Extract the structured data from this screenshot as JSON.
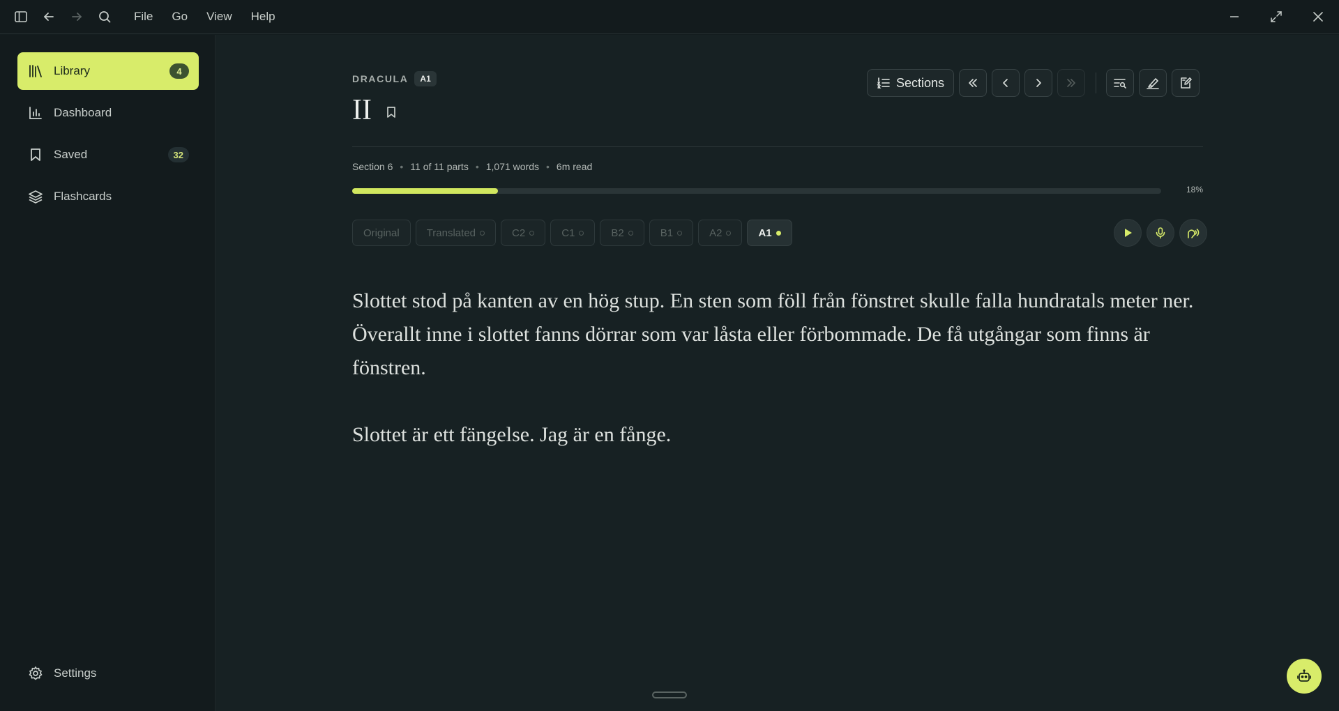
{
  "menu": [
    "File",
    "Go",
    "View",
    "Help"
  ],
  "sidebar": {
    "items": [
      {
        "label": "Library",
        "badge": "4",
        "icon": "library-icon",
        "active": true
      },
      {
        "label": "Dashboard",
        "badge": "",
        "icon": "chart-icon",
        "active": false
      },
      {
        "label": "Saved",
        "badge": "32",
        "icon": "bookmark-icon",
        "active": false
      },
      {
        "label": "Flashcards",
        "badge": "",
        "icon": "layers-icon",
        "active": false
      }
    ],
    "settings_label": "Settings"
  },
  "book": {
    "title": "DRACULA",
    "level": "A1",
    "chapter": "II"
  },
  "toolbar": {
    "sections_label": "Sections"
  },
  "meta": {
    "section": "Section 6",
    "parts": "11 of 11 parts",
    "words": "1,071 words",
    "read_time": "6m read"
  },
  "progress": {
    "value": 0.18,
    "label": "18%"
  },
  "levels": [
    {
      "label": "Original",
      "ring": false,
      "active": false
    },
    {
      "label": "Translated",
      "ring": true,
      "active": false
    },
    {
      "label": "C2",
      "ring": true,
      "active": false
    },
    {
      "label": "C1",
      "ring": true,
      "active": false
    },
    {
      "label": "B2",
      "ring": true,
      "active": false
    },
    {
      "label": "B1",
      "ring": true,
      "active": false
    },
    {
      "label": "A2",
      "ring": true,
      "active": false
    },
    {
      "label": "A1",
      "ring": true,
      "active": true
    }
  ],
  "reader": {
    "paragraphs": [
      "Slottet stod på kanten av en hög stup. En sten som föll från fönstret skulle falla hundratals meter ner. Överallt inne i slottet fanns dörrar som var låsta eller förbommade. De få utgångar som finns är fönstren.",
      "Slottet är ett fängelse. Jag är en fånge."
    ]
  },
  "colors": {
    "accent": "#d8ec6a",
    "background": "#172123",
    "sidebar": "#131b1d"
  }
}
